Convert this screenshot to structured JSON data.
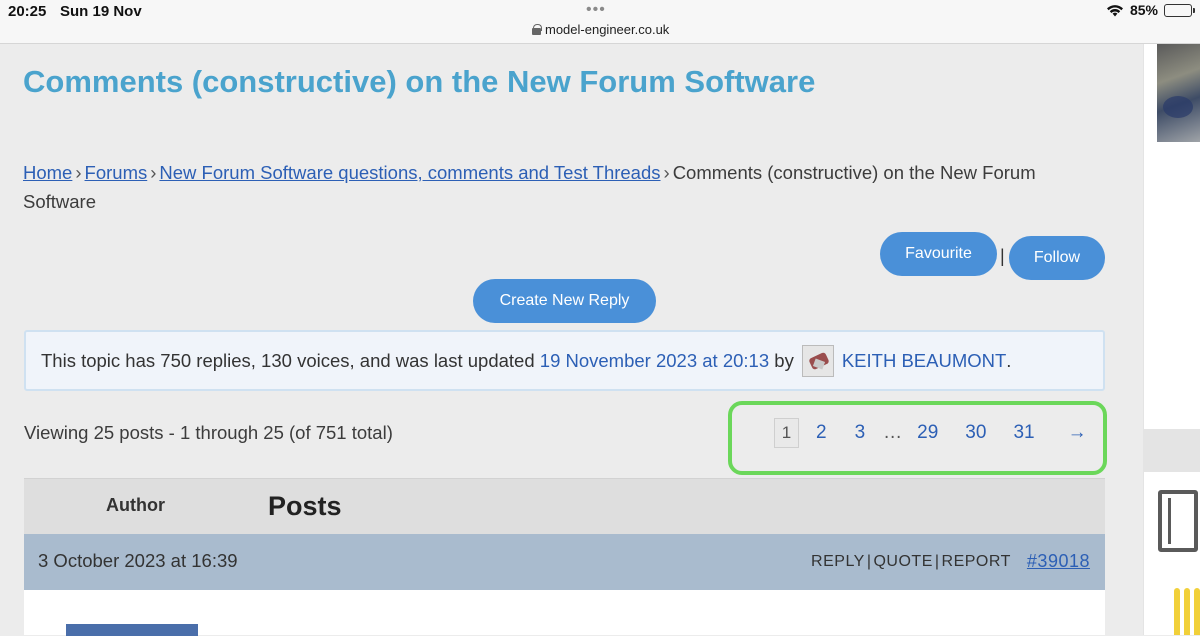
{
  "status_bar": {
    "time": "20:25",
    "date": "Sun 19 Nov",
    "url": "model-engineer.co.uk",
    "battery": "85%",
    "battery_level": 0.85
  },
  "page": {
    "title": "Comments (constructive) on the New Forum Software"
  },
  "breadcrumb": {
    "items": [
      {
        "label": "Home"
      },
      {
        "label": "Forums"
      },
      {
        "label": "New Forum Software questions, comments and Test Threads"
      }
    ],
    "separator": "›",
    "current": "Comments (constructive) on the New Forum Software"
  },
  "actions": {
    "favourite": "Favourite",
    "pipe": "|",
    "follow": "Follow",
    "create_reply": "Create New Reply"
  },
  "topic_info": {
    "prefix": "This topic has 750 replies, 130 voices, and was last updated",
    "updated": "19 November 2023 at 20:13",
    "by": "by",
    "author": "KEITH BEAUMONT",
    "suffix": "."
  },
  "viewing": "Viewing 25 posts - 1 through 25 (of 751 total)",
  "pagination": {
    "current": "1",
    "pages": [
      "2",
      "3"
    ],
    "ellipsis": "…",
    "last_pages": [
      "29",
      "30",
      "31"
    ],
    "next": "→"
  },
  "posts_header": {
    "author": "Author",
    "posts": "Posts"
  },
  "post": {
    "date": "3 October 2023 at 16:39",
    "reply": "REPLY",
    "quote": "QUOTE",
    "report": "REPORT",
    "sep": "|",
    "id": "#39018"
  },
  "colors": {
    "title": "#4aa3cd",
    "link": "#2c5fb5",
    "button": "#4a90d8",
    "pager_highlight": "#6bd75a",
    "post_meta_bg": "#a9bbce"
  }
}
